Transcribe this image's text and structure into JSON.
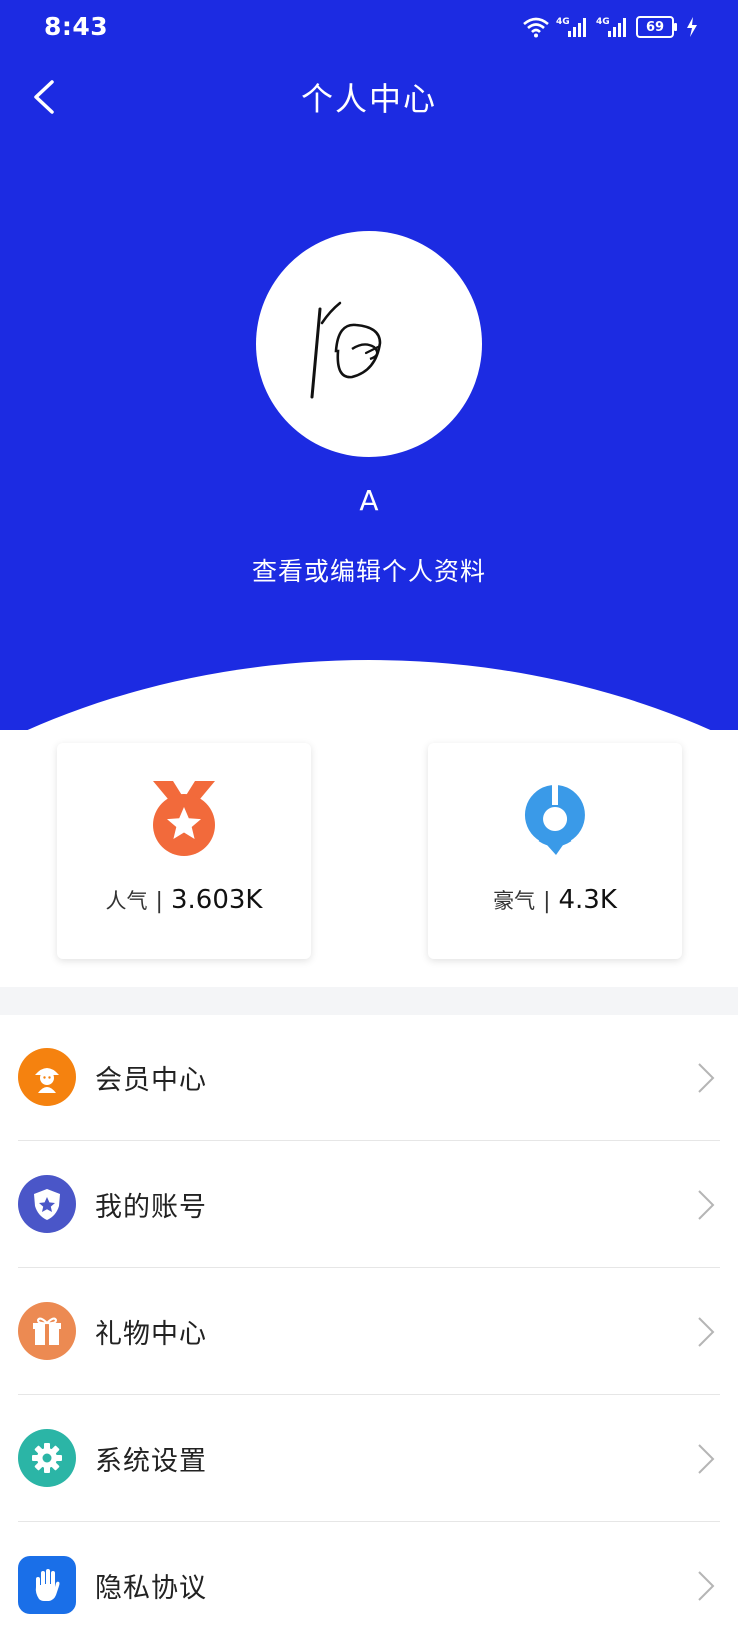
{
  "status_bar": {
    "time": "8:43",
    "battery": "69",
    "network_1": "4G",
    "network_2": "4G"
  },
  "header": {
    "title": "个人中心",
    "background_color": "#1c2be2"
  },
  "profile": {
    "username": "A",
    "edit_link": "查看或编辑个人资料",
    "avatar": "handwritten-signature-avatar"
  },
  "stats": [
    {
      "label": "人气",
      "separator": "|",
      "value": "3.603K",
      "icon": "medal-icon",
      "color": "#f26a3b"
    },
    {
      "label": "豪气",
      "separator": "|",
      "value": "4.3K",
      "icon": "pin-ring-icon",
      "color": "#3a9ae8"
    }
  ],
  "menu": [
    {
      "label": "会员中心",
      "icon": "member-icon",
      "color": "#f5820f"
    },
    {
      "label": "我的账号",
      "icon": "account-shield-icon",
      "color": "#4a56c8"
    },
    {
      "label": "礼物中心",
      "icon": "gift-icon",
      "color": "#ec8a52"
    },
    {
      "label": "系统设置",
      "icon": "gear-icon",
      "color": "#2bb5a6"
    },
    {
      "label": "隐私协议",
      "icon": "hand-icon",
      "color": "#1a6fe8"
    }
  ]
}
